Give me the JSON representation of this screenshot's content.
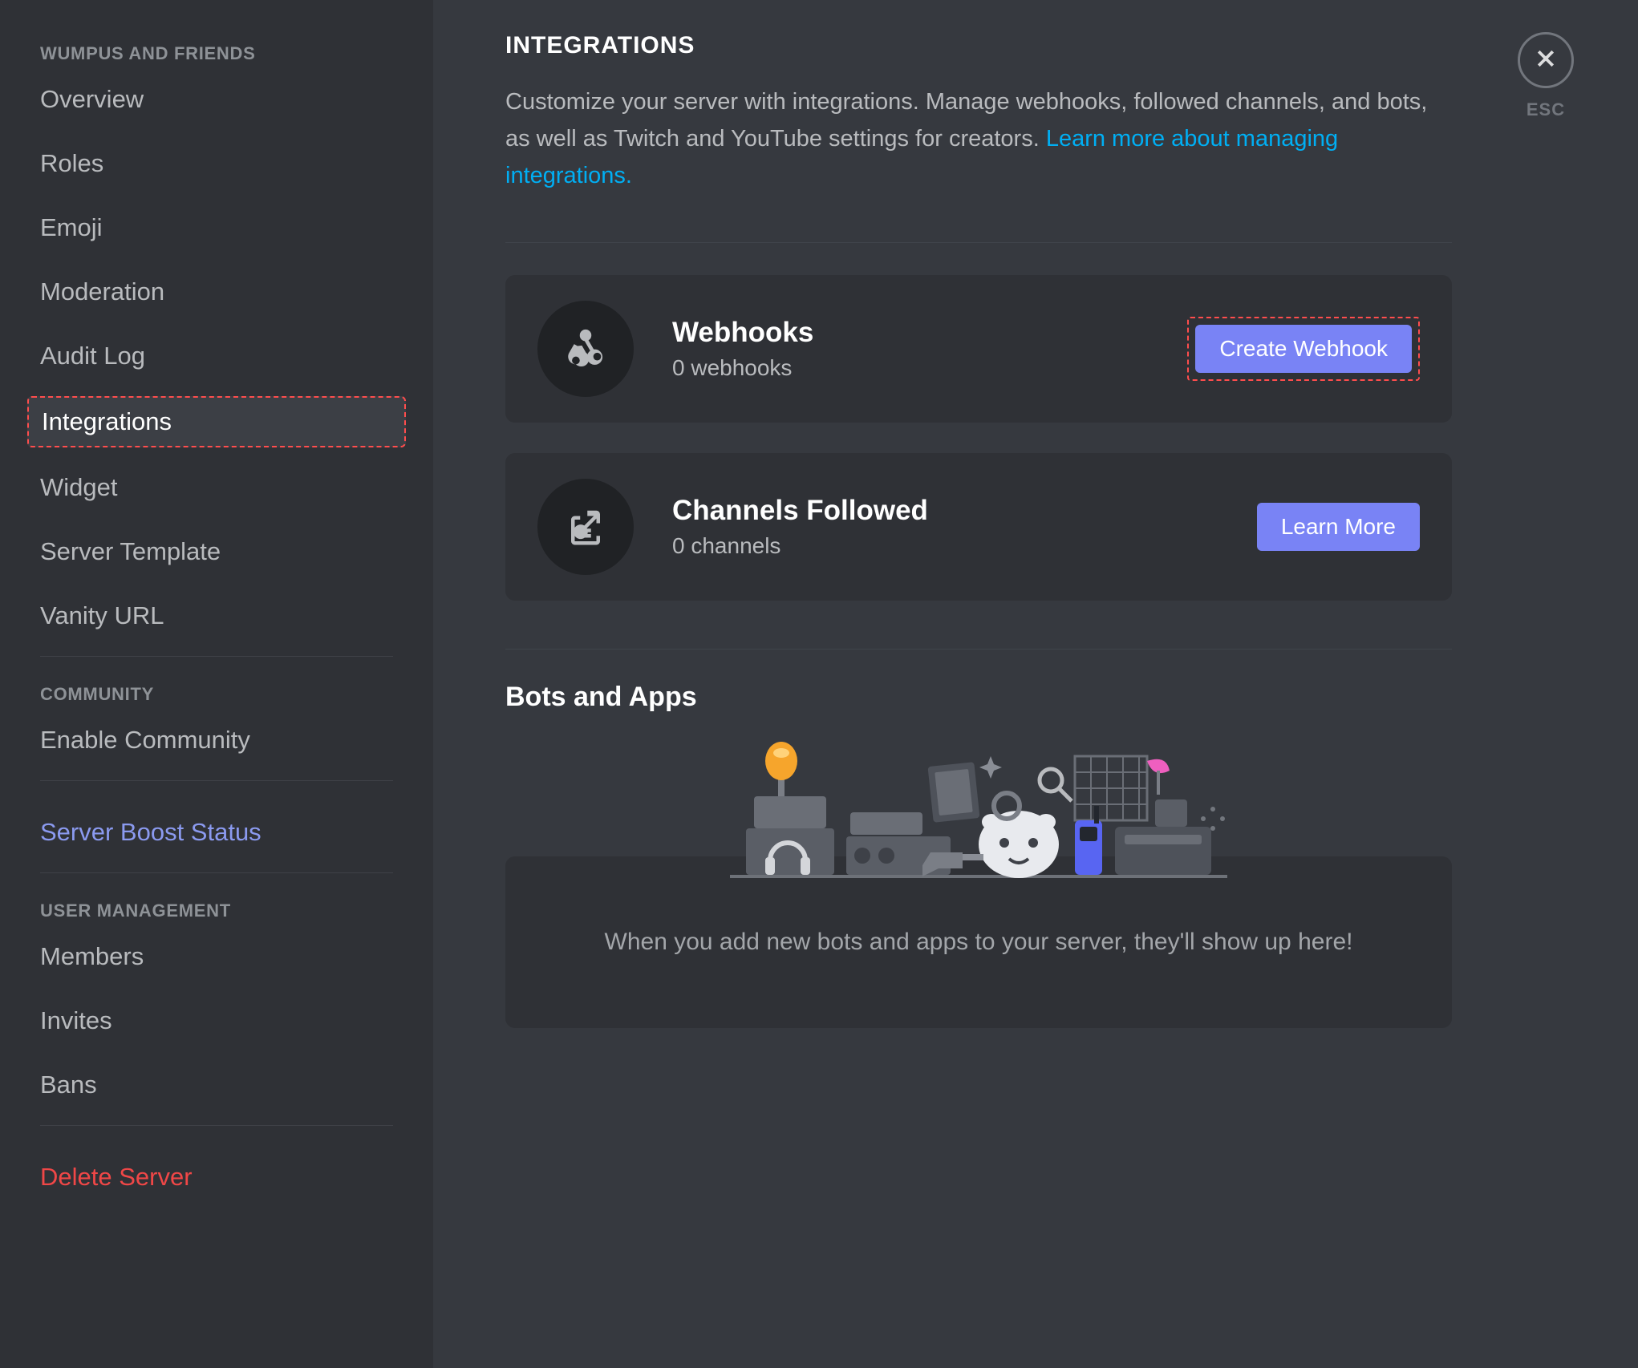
{
  "sidebar": {
    "section1_header": "WUMPUS AND FRIENDS",
    "items1": [
      {
        "label": "Overview"
      },
      {
        "label": "Roles"
      },
      {
        "label": "Emoji"
      },
      {
        "label": "Moderation"
      },
      {
        "label": "Audit Log"
      },
      {
        "label": "Integrations"
      },
      {
        "label": "Widget"
      },
      {
        "label": "Server Template"
      },
      {
        "label": "Vanity URL"
      }
    ],
    "section2_header": "COMMUNITY",
    "items2": [
      {
        "label": "Enable Community"
      }
    ],
    "boost_label": "Server Boost Status",
    "section3_header": "USER MANAGEMENT",
    "items3": [
      {
        "label": "Members"
      },
      {
        "label": "Invites"
      },
      {
        "label": "Bans"
      }
    ],
    "delete_label": "Delete Server"
  },
  "close": {
    "label": "ESC"
  },
  "page": {
    "title": "INTEGRATIONS",
    "desc_prefix": "Customize your server with integrations. Manage webhooks, followed channels, and bots, as well as Twitch and YouTube settings for creators. ",
    "desc_link": "Learn more about managing integrations."
  },
  "cards": {
    "webhooks": {
      "title": "Webhooks",
      "sub": "0 webhooks",
      "button": "Create Webhook"
    },
    "channels": {
      "title": "Channels Followed",
      "sub": "0 channels",
      "button": "Learn More"
    }
  },
  "bots": {
    "heading": "Bots and Apps",
    "empty": "When you add new bots and apps to your server, they'll show up here!"
  }
}
